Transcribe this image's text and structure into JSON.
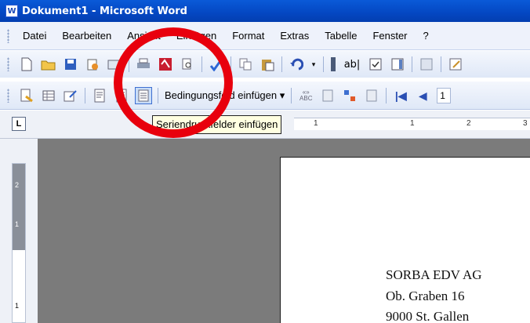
{
  "window": {
    "title": "Dokument1 - Microsoft Word",
    "app_icon_letter": "W"
  },
  "menu": [
    "Datei",
    "Bearbeiten",
    "Ansicht",
    "Einfügen",
    "Format",
    "Extras",
    "Tabelle",
    "Fenster",
    "?"
  ],
  "mailmerge_toolbar": {
    "field_button_label": "Bedingungsfeld einfügen ▾",
    "record_number": "1"
  },
  "tooltip": {
    "text": "Seriendruckfelder einfügen"
  },
  "ruler": {
    "h_labels": [
      "1",
      "1",
      "2",
      "3"
    ],
    "v_labels": [
      "2",
      "1",
      "1"
    ]
  },
  "document": {
    "address_lines": [
      "SORBA EDV AG",
      "Ob. Graben 16",
      "9000 St. Gallen"
    ]
  },
  "colors": {
    "titlebar": "#0447c2",
    "highlight": "#e8000d",
    "tooltip_bg": "#ffffe1"
  }
}
